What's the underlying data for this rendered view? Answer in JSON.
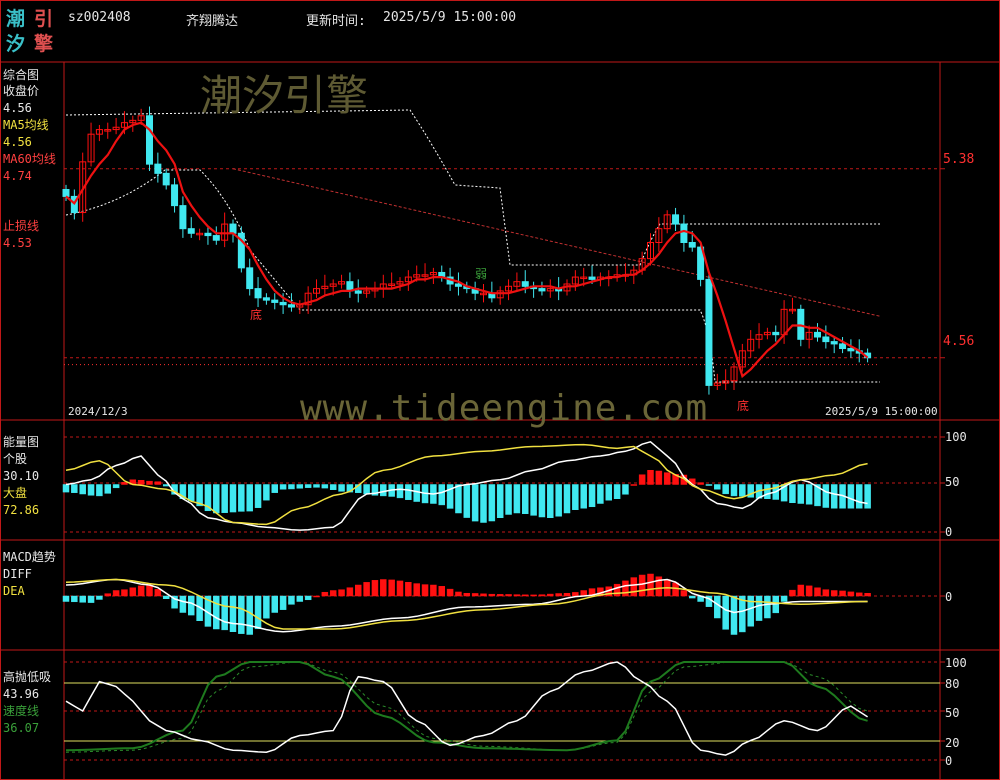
{
  "header": {
    "logo_chars": [
      "潮",
      "引",
      "汐",
      "擎"
    ],
    "code": "sz002408",
    "name": "齐翔腾达",
    "update_label": "更新时间:",
    "update_time": "2025/5/9 15:00:00"
  },
  "watermark": {
    "brand": "潮汐引擎",
    "url": "www.tideengine.com"
  },
  "colors": {
    "rise": "#ff1010",
    "fall": "#40e8f0",
    "ma": "#ee1111",
    "white": "#ffffff",
    "yellow": "#f0e040",
    "green": "#1e7a1e",
    "grid": "#c01818"
  },
  "panels": {
    "main": {
      "title": "综合图",
      "close_label": "收盘价",
      "close_value": "4.56",
      "ma5_label": "MA5均线",
      "ma5_value": "4.56",
      "ma60_label": "MA60均线",
      "ma60_value": "4.74",
      "stop_label": "止损线",
      "stop_value": "4.53",
      "price_high": "5.38",
      "price_low": "4.56",
      "date_start": "2024/12/3",
      "date_end": "2025/5/9 15:00:00",
      "tags": {
        "bottom1": "底",
        "weak": "弱",
        "bottom2": "底"
      }
    },
    "energy": {
      "title": "能量图",
      "stock_label": "个股",
      "stock_value": "30.10",
      "market_label": "大盘",
      "market_value": "72.86",
      "axis": [
        "100",
        "50",
        "0"
      ]
    },
    "macd": {
      "title": "MACD趋势",
      "diff_label": "DIFF",
      "dea_label": "DEA",
      "axis": [
        "0"
      ]
    },
    "tide": {
      "title": "高抛低吸",
      "value": "43.96",
      "speed_label": "速度线",
      "speed_value": "36.07",
      "axis": [
        "100",
        "80",
        "50",
        "20",
        "0"
      ]
    }
  },
  "chart_data": {
    "type": "candlestick",
    "count": 97,
    "x_start": "2024/12/3",
    "x_end": "2025/5/9",
    "price_axis_ticks": [
      5.38,
      4.56
    ],
    "closes": [
      5.26,
      5.19,
      5.41,
      5.53,
      5.55,
      5.55,
      5.56,
      5.58,
      5.59,
      5.61,
      5.4,
      5.36,
      5.31,
      5.22,
      5.12,
      5.1,
      5.1,
      5.09,
      5.07,
      5.14,
      5.1,
      4.95,
      4.86,
      4.82,
      4.81,
      4.8,
      4.79,
      4.78,
      4.79,
      4.84,
      4.86,
      4.87,
      4.88,
      4.89,
      4.85,
      4.84,
      4.85,
      4.86,
      4.88,
      4.88,
      4.89,
      4.91,
      4.92,
      4.92,
      4.93,
      4.91,
      4.88,
      4.87,
      4.86,
      4.84,
      4.84,
      4.82,
      4.85,
      4.87,
      4.89,
      4.87,
      4.86,
      4.85,
      4.86,
      4.85,
      4.88,
      4.91,
      4.91,
      4.9,
      4.91,
      4.91,
      4.92,
      4.92,
      4.94,
      4.99,
      5.06,
      5.12,
      5.18,
      5.14,
      5.06,
      5.04,
      4.9,
      4.44,
      4.45,
      4.46,
      4.52,
      4.59,
      4.64,
      4.66,
      4.67,
      4.66,
      4.77,
      4.77,
      4.64,
      4.67,
      4.65,
      4.63,
      4.62,
      4.6,
      4.59,
      4.58,
      4.56
    ],
    "ma5": [
      5.26,
      5.23,
      5.29,
      5.35,
      5.4,
      5.44,
      5.5,
      5.55,
      5.57,
      5.58,
      5.55,
      5.5,
      5.46,
      5.4,
      5.28,
      5.22,
      5.17,
      5.13,
      5.1,
      5.1,
      5.1,
      5.07,
      5.03,
      4.96,
      4.9,
      4.85,
      4.82,
      4.8,
      4.79,
      4.8,
      4.81,
      4.83,
      4.84,
      4.85,
      4.85,
      4.86,
      4.86,
      4.86,
      4.86,
      4.86,
      4.87,
      4.88,
      4.9,
      4.9,
      4.91,
      4.91,
      4.9,
      4.89,
      4.87,
      4.86,
      4.85,
      4.84,
      4.84,
      4.84,
      4.85,
      4.86,
      4.87,
      4.87,
      4.87,
      4.86,
      4.87,
      4.87,
      4.88,
      4.89,
      4.9,
      4.91,
      4.91,
      4.92,
      4.92,
      4.94,
      4.97,
      5.01,
      5.06,
      5.1,
      5.11,
      5.1,
      5.06,
      4.93,
      4.83,
      4.72,
      4.6,
      4.48,
      4.51,
      4.55,
      4.59,
      4.62,
      4.66,
      4.7,
      4.7,
      4.69,
      4.69,
      4.67,
      4.65,
      4.63,
      4.61,
      4.59,
      4.56
    ],
    "ma60_start": 5.38,
    "ma60_end": 4.74,
    "stop_value": 4.53
  }
}
